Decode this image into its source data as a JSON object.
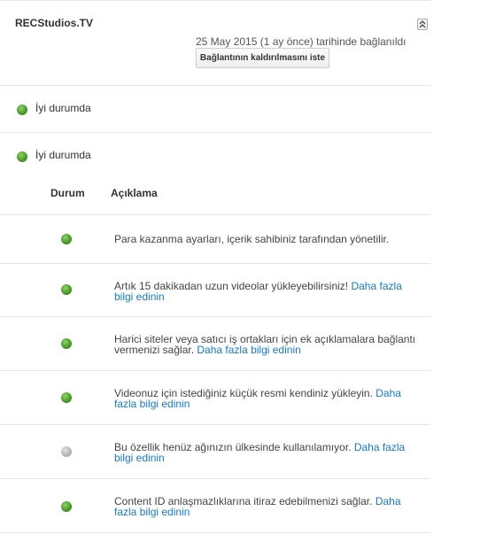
{
  "channel": {
    "name": "RECStudios.TV",
    "collapse_icon": "double-chevron-up-icon",
    "connected_text": "25 May 2015 (1 ay önce) tarihinde bağlanıldı",
    "disconnect_label": "Bağlantının kaldırılmasını iste"
  },
  "status_rows": [
    {
      "label": "İyi durumda",
      "status": "good"
    },
    {
      "label": "İyi durumda",
      "status": "good"
    }
  ],
  "table": {
    "headers": {
      "status": "Durum",
      "description": "Açıklama"
    },
    "rows": [
      {
        "status": "good",
        "text": "Para kazanma ayarları, içerik sahibiniz tarafından yönetilir.",
        "link": ""
      },
      {
        "status": "good",
        "text": "Artık 15 dakikadan uzun videolar yükleyebilirsiniz! ",
        "link": "Daha fazla bilgi edinin"
      },
      {
        "status": "good",
        "text": "Harici siteler veya satıcı iş ortakları için ek açıklamalara bağlantı vermenizi sağlar. ",
        "link": "Daha fazla bilgi edinin"
      },
      {
        "status": "good",
        "text": "Videonuz için istediğiniz küçük resmi kendiniz yükleyin. ",
        "link": "Daha fazla bilgi edinin"
      },
      {
        "status": "unavailable",
        "text": "Bu özellik henüz ağınızın ülkesinde kullanılamıyor. ",
        "link": "Daha fazla bilgi edinin"
      },
      {
        "status": "good",
        "text": "Content ID anlaşmazlıklarına itiraz edebilmenizi sağlar. ",
        "link": "Daha fazla bilgi edinin"
      }
    ]
  },
  "colors": {
    "good": "#4a9a2a",
    "unavailable": "#b3b3b3",
    "link": "#167ac6"
  }
}
